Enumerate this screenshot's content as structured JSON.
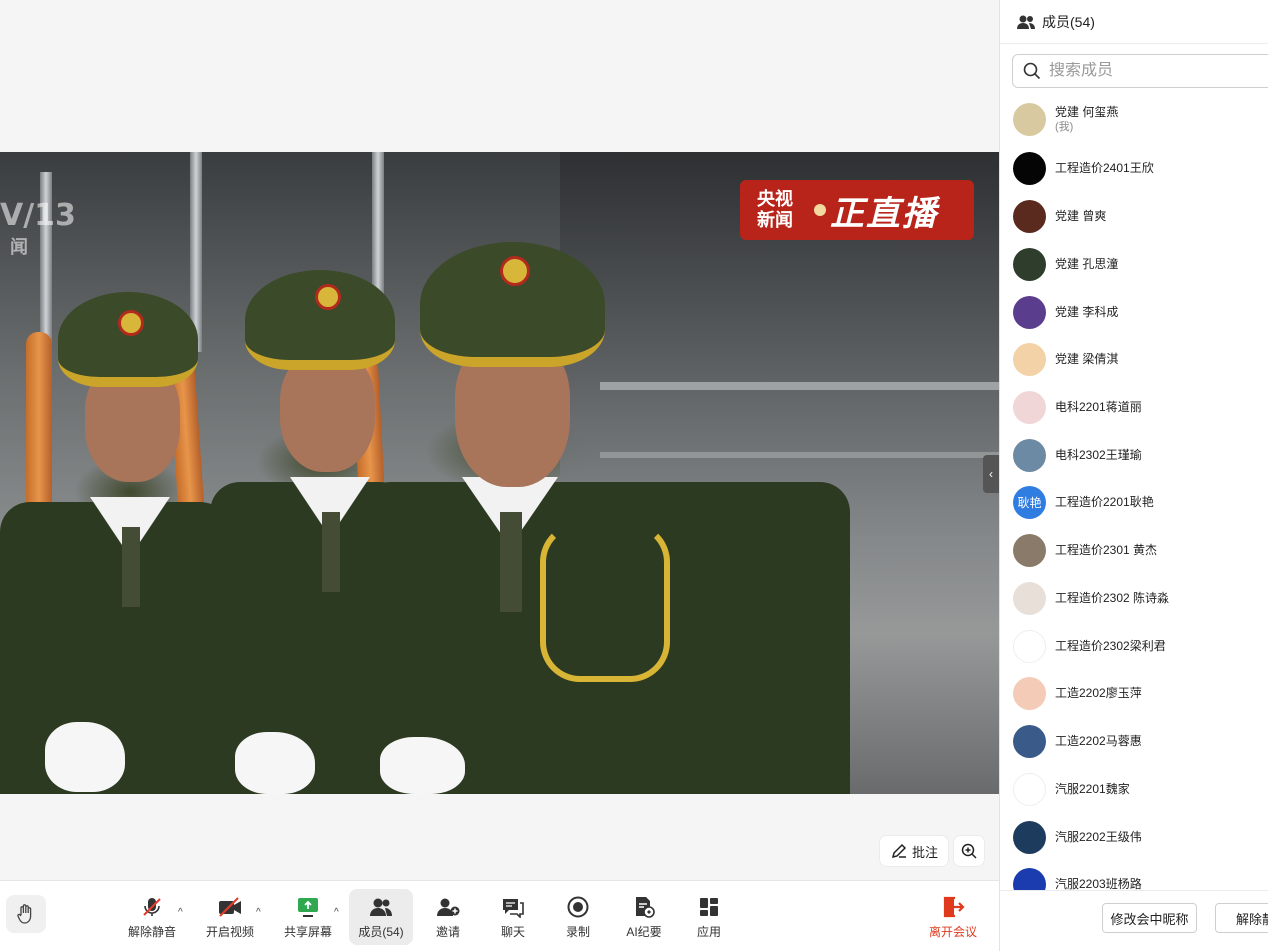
{
  "video": {
    "channel_logo_line1": "央视",
    "channel_logo_line2": "新闻",
    "channel_logo_live": "正直播",
    "corner_mark_line1": "V/13",
    "corner_mark_line2": "闻"
  },
  "annotations": {
    "annotate_label": "批注"
  },
  "toolbar": {
    "unmute": "解除静音",
    "start_video": "开启视频",
    "share_screen": "共享屏幕",
    "members": "成员(54)",
    "invite": "邀请",
    "chat": "聊天",
    "record": "录制",
    "ai_minutes": "AI纪要",
    "apps": "应用",
    "leave": "离开会议"
  },
  "panel": {
    "title": "成员(54)",
    "search_placeholder": "搜索成员",
    "me_suffix": "(我)",
    "members": [
      {
        "name": "党建 何玺燕",
        "avatar": "",
        "color": "#d9c9a0"
      },
      {
        "name": "工程造价2401王欣",
        "avatar": "",
        "color": "#050505"
      },
      {
        "name": "党建 曾爽",
        "avatar": "",
        "color": "#5a2a1e"
      },
      {
        "name": "党建 孔思潼",
        "avatar": "",
        "color": "#2e3d2c"
      },
      {
        "name": "党建 李科成",
        "avatar": "",
        "color": "#5b3d8e"
      },
      {
        "name": "党建 梁倩淇",
        "avatar": "",
        "color": "#f2d2a6"
      },
      {
        "name": "电科2201蒋道丽",
        "avatar": "",
        "color": "#f0d6d6"
      },
      {
        "name": "电科2302王瑾瑜",
        "avatar": "",
        "color": "#6c8aa4"
      },
      {
        "name": "工程造价2201耿艳",
        "avatar": "耿艳",
        "color": "#2f7de1"
      },
      {
        "name": "工程造价2301 黄杰",
        "avatar": "",
        "color": "#8a7a6a"
      },
      {
        "name": "工程造价2302 陈诗淼",
        "avatar": "",
        "color": "#e8e0d8"
      },
      {
        "name": "工程造价2302梁利君",
        "avatar": "",
        "color": "#ffffff"
      },
      {
        "name": "工造2202廖玉萍",
        "avatar": "",
        "color": "#f3cbb6"
      },
      {
        "name": "工造2202马蓉惠",
        "avatar": "",
        "color": "#3a5a8a"
      },
      {
        "name": "汽服2201魏家",
        "avatar": "",
        "color": "#ffffff"
      },
      {
        "name": "汽服2202王级伟",
        "avatar": "",
        "color": "#1d3b5c"
      },
      {
        "name": "汽服2203班杨路",
        "avatar": "",
        "color": "#1b3cae"
      }
    ],
    "footer": {
      "rename": "修改会中昵称",
      "unmute_all": "解除静"
    }
  }
}
